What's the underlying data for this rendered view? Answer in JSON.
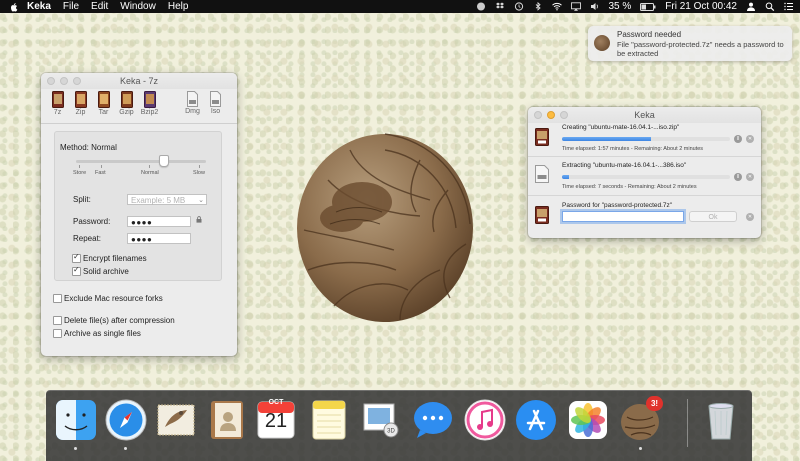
{
  "menubar": {
    "app_name": "Keka",
    "menus": [
      "File",
      "Edit",
      "Window",
      "Help"
    ],
    "battery": "35 %",
    "datetime": "Fri 21 Oct  00:42"
  },
  "notification": {
    "title": "Password needed",
    "body": "File \"password-protected.7z\" needs a password to be extracted"
  },
  "main_window": {
    "title": "Keka - 7z",
    "formats": [
      "7z",
      "Zip",
      "Tar",
      "Gzip",
      "Bzip2",
      "Dmg",
      "Iso"
    ],
    "method_label": "Method: Normal",
    "compression_level": 0.67,
    "speed_labels": [
      "Store",
      "Fast",
      "Normal",
      "Slow"
    ],
    "split_label": "Split:",
    "split_placeholder": "Example: 5 MB",
    "password_label": "Password:",
    "password_value": "●●●●",
    "repeat_label": "Repeat:",
    "repeat_value": "●●●●",
    "options": [
      {
        "label": "Encrypt filenames",
        "checked": true
      },
      {
        "label": "Solid archive",
        "checked": true
      },
      {
        "label": "Exclude Mac resource forks",
        "checked": false
      },
      {
        "label": "Delete file(s) after compression",
        "checked": false
      },
      {
        "label": "Archive as single files",
        "checked": false
      }
    ]
  },
  "progress_window": {
    "title": "Keka",
    "tasks": [
      {
        "title": "Creating \"ubuntu-mate-16.04.1-...iso.zip\"",
        "progress": 0.53,
        "status": "Time elapsed: 1:57 minutes - Remaining: About 2 minutes",
        "pause": "II"
      },
      {
        "title": "Extracting \"ubuntu-mate-16.04.1-...386.iso\"",
        "progress": 0.04,
        "status": "Time elapsed: 7 seconds - Remaining: About 2 minutes",
        "pause": "II"
      }
    ],
    "password_prompt": "Password for \"password-protected.7z\"",
    "ok_label": "Ok"
  },
  "dock": {
    "calendar_month": "OCT",
    "calendar_day": "21",
    "badge": "3!",
    "items": [
      "Finder",
      "Safari",
      "Mail",
      "Contacts",
      "Calendar",
      "Notes",
      "Preview",
      "Messages",
      "iTunes",
      "App Store",
      "Photos",
      "Keka",
      "Trash"
    ]
  }
}
